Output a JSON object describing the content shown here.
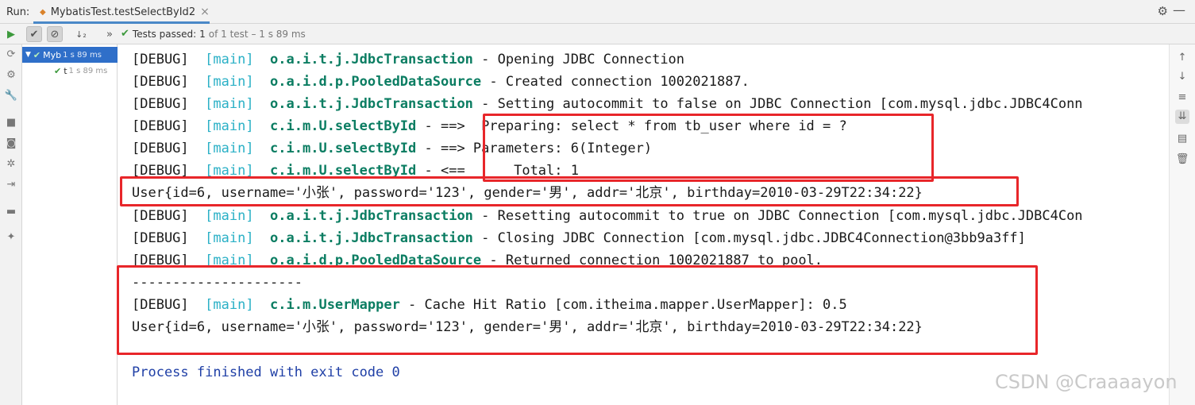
{
  "topbar": {
    "run_label": "Run:",
    "tab_title": "MybatisTest.testSelectById2",
    "tab_close": "×",
    "tab_icon": "test-class-icon",
    "gear": "⚙",
    "minimize": "—"
  },
  "toolbar": {
    "rerun_icon": "▶",
    "show_passed_icon": "✔",
    "show_ignored_icon": "⊘",
    "sort_icon": "↓₂",
    "more_icon": "»",
    "status_check": "✔",
    "status_main": "Tests passed:",
    "status_count": "1",
    "status_detail": "of 1 test – 1 s 89 ms"
  },
  "tree": {
    "root_label": "Myb",
    "root_duration": "1 s 89 ms",
    "child_label": "t",
    "child_duration": "1 s 89 ms"
  },
  "console": {
    "lines": [
      {
        "level": "[DEBUG]",
        "thread": "[main]",
        "logger": "o.a.i.t.j.JdbcTransaction",
        "message": " - Opening JDBC Connection"
      },
      {
        "level": "[DEBUG]",
        "thread": "[main]",
        "logger": "o.a.i.d.p.PooledDataSource",
        "message": " - Created connection 1002021887."
      },
      {
        "level": "[DEBUG]",
        "thread": "[main]",
        "logger": "o.a.i.t.j.JdbcTransaction",
        "message": " - Setting autocommit to false on JDBC Connection [com.mysql.jdbc.JDBC4Conn"
      },
      {
        "level": "[DEBUG]",
        "thread": "[main]",
        "logger": "c.i.m.U.selectById",
        "message": " - ==>  Preparing: select * from tb_user where id = ?"
      },
      {
        "level": "[DEBUG]",
        "thread": "[main]",
        "logger": "c.i.m.U.selectById",
        "message": " - ==> Parameters: 6(Integer)"
      },
      {
        "level": "[DEBUG]",
        "thread": "[main]",
        "logger": "c.i.m.U.selectById",
        "message": " - <==      Total: 1"
      },
      {
        "plain": "User{id=6, username='小张', password='123', gender='男', addr='北京', birthday=2010-03-29T22:34:22}"
      },
      {
        "level": "[DEBUG]",
        "thread": "[main]",
        "logger": "o.a.i.t.j.JdbcTransaction",
        "message": " - Resetting autocommit to true on JDBC Connection [com.mysql.jdbc.JDBC4Con"
      },
      {
        "level": "[DEBUG]",
        "thread": "[main]",
        "logger": "o.a.i.t.j.JdbcTransaction",
        "message": " - Closing JDBC Connection [com.mysql.jdbc.JDBC4Connection@3bb9a3ff]"
      },
      {
        "level": "[DEBUG]",
        "thread": "[main]",
        "logger": "o.a.i.d.p.PooledDataSource",
        "message": " - Returned connection 1002021887 to pool."
      },
      {
        "plain": "---------------------"
      },
      {
        "level": "[DEBUG]",
        "thread": "[main]",
        "logger": "c.i.m.UserMapper",
        "message": " - Cache Hit Ratio [com.itheima.mapper.UserMapper]: 0.5"
      },
      {
        "plain": "User{id=6, username='小张', password='123', gender='男', addr='北京', birthday=2010-03-29T22:34:22}"
      },
      {
        "plain": ""
      },
      {
        "process": "Process finished with exit code 0"
      }
    ]
  },
  "watermark": "CSDN @Craaaayon",
  "colors": {
    "highlight_box": "#e8262a",
    "thread": "#2ab0c6",
    "logger": "#0b7d62",
    "process": "#1f3fa6",
    "selection": "#2f6fc9"
  }
}
